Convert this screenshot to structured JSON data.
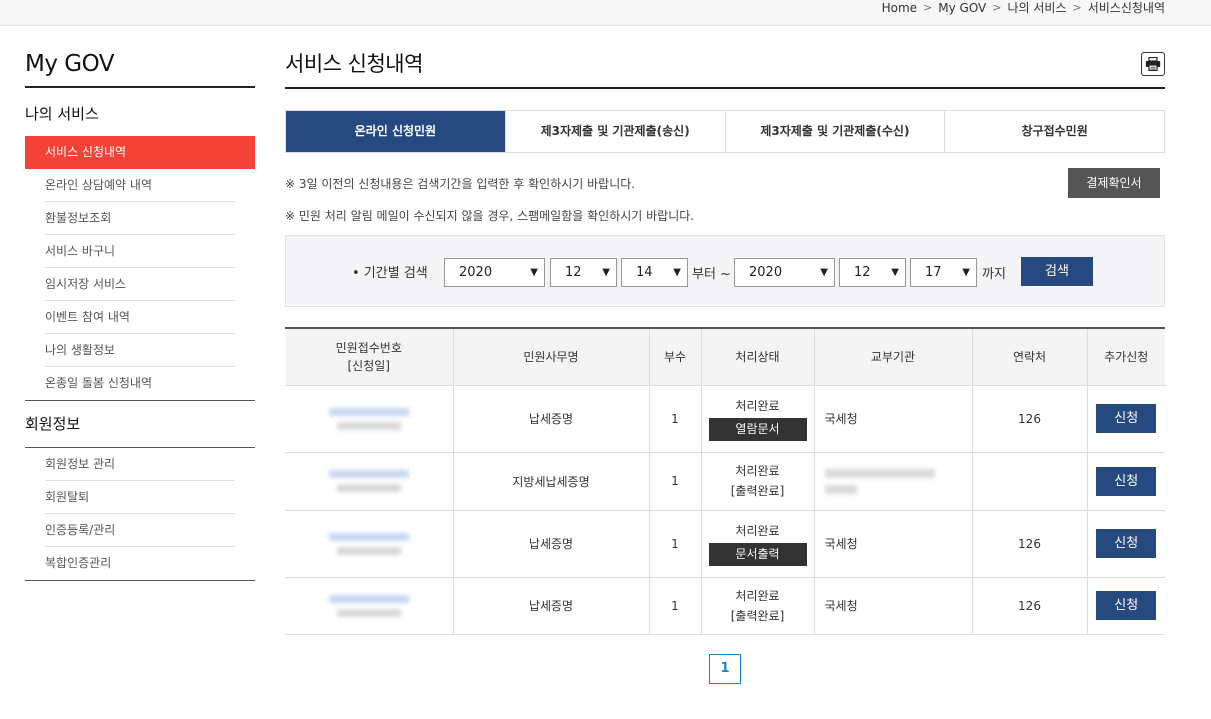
{
  "breadcrumb": [
    "Home",
    "My GOV",
    "나의 서비스",
    "서비스신청내역"
  ],
  "breadcrumb_separator": ">",
  "sidebar": {
    "title": "My GOV",
    "group1_title": "나의 서비스",
    "group1_items": [
      "서비스 신청내역",
      "온라인 상담예약 내역",
      "환불정보조회",
      "서비스 바구니",
      "임시저장 서비스",
      "이벤트 참여 내역",
      "나의 생활정보",
      "온종일 돌봄 신청내역"
    ],
    "group2_title": "회원정보",
    "group2_items": [
      "회원정보 관리",
      "회원탈퇴",
      "인증등록/관리",
      "복합인증관리"
    ]
  },
  "main": {
    "page_title": "서비스 신청내역",
    "print_icon": "printer-icon",
    "tabs": [
      "온라인 신청민원",
      "제3자제출 및 기관제출(송신)",
      "제3자제출 및 기관제출(수신)",
      "창구접수민원"
    ],
    "notice1": "※ 3일 이전의 신청내용은 검색기간을 입력한 후 확인하시기 바랍니다.",
    "notice2": "※ 민원 처리 알림 메일이 수신되지 않을 경우, 스팸메일함을 확인하시기 바랍니다.",
    "pay_button": "결제확인서"
  },
  "search": {
    "label": "• 기간별 검색",
    "from_year": "2020",
    "from_month": "12",
    "from_day": "14",
    "from_text": "부터 ~",
    "to_year": "2020",
    "to_month": "12",
    "to_day": "17",
    "to_text": "까지",
    "button": "검색"
  },
  "table": {
    "headers": [
      "민원접수번호",
      "[신청일]",
      "민원사무명",
      "부수",
      "처리상태",
      "교부기관",
      "연락처",
      "추가신청"
    ],
    "rows": [
      {
        "name": "납세증명",
        "count": "1",
        "status": "처리완료",
        "status_sub": "열람문서",
        "agency": "국세청",
        "contact": "126",
        "apply": "신청"
      },
      {
        "name": "지방세납세증명",
        "count": "1",
        "status": "처리완료",
        "status_sub": "[출력완료]",
        "agency": "",
        "contact": "",
        "apply": "신청"
      },
      {
        "name": "납세증명",
        "count": "1",
        "status": "처리완료",
        "status_sub": "문서출력",
        "agency": "국세청",
        "contact": "126",
        "apply": "신청"
      },
      {
        "name": "납세증명",
        "count": "1",
        "status": "처리완료",
        "status_sub": "[출력완료]",
        "agency": "국세청",
        "contact": "126",
        "apply": "신청"
      }
    ]
  },
  "pagination": {
    "current": "1"
  }
}
